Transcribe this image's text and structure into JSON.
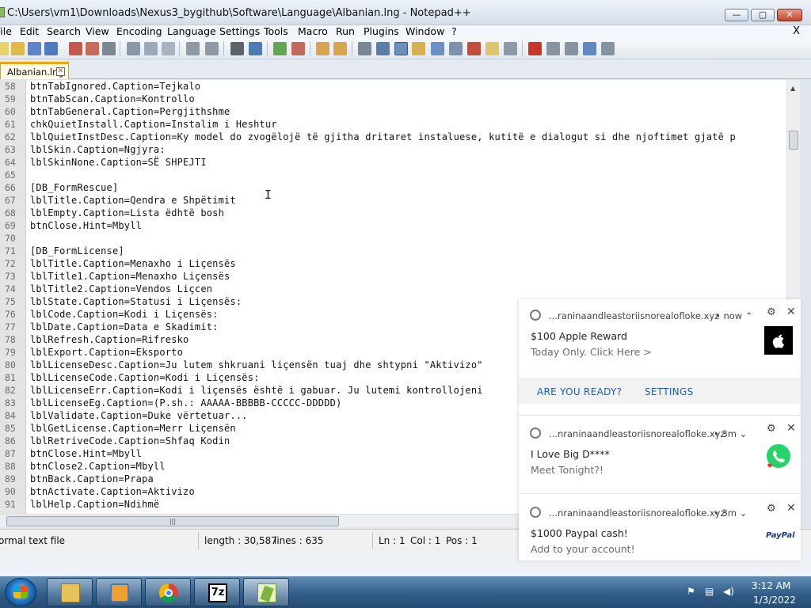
{
  "window": {
    "title": "C:\\Users\\vm1\\Downloads\\Nexus3_bygithub\\Software\\Language\\Albanian.lng - Notepad++",
    "min_label": "—",
    "max_label": "▢",
    "close_label": "✕"
  },
  "menu": {
    "items": [
      "File",
      "Edit",
      "Search",
      "View",
      "Encoding",
      "Language",
      "Settings",
      "Tools",
      "Macro",
      "Run",
      "Plugins",
      "Window",
      "?"
    ],
    "close": "X"
  },
  "tab": {
    "label": "Albanian.lng",
    "close": "✕"
  },
  "editor": {
    "lines": [
      {
        "n": "58",
        "t": "btnTabIgnored.Caption=Tejkalo"
      },
      {
        "n": "59",
        "t": "btnTabScan.Caption=Kontrollo"
      },
      {
        "n": "60",
        "t": "btnTabGeneral.Caption=Pergjithshme"
      },
      {
        "n": "61",
        "t": "chkQuietInstall.Caption=Instalim i Heshtur"
      },
      {
        "n": "62",
        "t": "lblQuietInstDesc.Caption=Ky model do zvogëlojë të gjitha dritaret instaluese, kutitë e dialogut si dhe njoftimet gjatë p"
      },
      {
        "n": "63",
        "t": "lblSkin.Caption=Ngjyra:"
      },
      {
        "n": "64",
        "t": "lblSkinNone.Caption=SË SHPEJTI"
      },
      {
        "n": "65",
        "t": ""
      },
      {
        "n": "66",
        "t": "[DB_FormRescue]"
      },
      {
        "n": "67",
        "t": "lblTitle.Caption=Qendra e Shpëtimit"
      },
      {
        "n": "68",
        "t": "lblEmpty.Caption=Lista ëdhtë bosh"
      },
      {
        "n": "69",
        "t": "btnClose.Hint=Mbyll"
      },
      {
        "n": "70",
        "t": ""
      },
      {
        "n": "71",
        "t": "[DB_FormLicense]"
      },
      {
        "n": "72",
        "t": "lblTitle.Caption=Menaxho i Liçensës"
      },
      {
        "n": "73",
        "t": "lblTitle1.Caption=Menaxho Liçensës"
      },
      {
        "n": "74",
        "t": "lblTitle2.Caption=Vendos Liçcen"
      },
      {
        "n": "75",
        "t": "lblState.Caption=Statusi i Liçensës:"
      },
      {
        "n": "76",
        "t": "lblCode.Caption=Kodi i Liçensës:"
      },
      {
        "n": "77",
        "t": "lblDate.Caption=Data e Skadimit:"
      },
      {
        "n": "78",
        "t": "lblRefresh.Caption=Rifresko"
      },
      {
        "n": "79",
        "t": "lblExport.Caption=Eksporto"
      },
      {
        "n": "80",
        "t": "lblLicenseDesc.Caption=Ju lutem shkruani liçensën tuaj dhe shtypni \"Aktivizo\""
      },
      {
        "n": "81",
        "t": "lblLicenseCode.Caption=Kodi i Liçensës:"
      },
      {
        "n": "82",
        "t": "lblLicenseErr.Caption=Kodi i liçensës është i gabuar. Ju lutemi kontrollojeni"
      },
      {
        "n": "83",
        "t": "lblLicenseEg.Caption=(P.sh.: AAAAA-BBBBB-CCCCC-DDDDD)"
      },
      {
        "n": "84",
        "t": "lblValidate.Caption=Duke vërtetuar..."
      },
      {
        "n": "85",
        "t": "lblGetLicense.Caption=Merr Liçensën"
      },
      {
        "n": "86",
        "t": "lblRetriveCode.Caption=Shfaq Kodin"
      },
      {
        "n": "87",
        "t": "btnClose.Hint=Mbyll"
      },
      {
        "n": "88",
        "t": "btnClose2.Caption=Mbyll"
      },
      {
        "n": "89",
        "t": "btnBack.Caption=Prapa"
      },
      {
        "n": "90",
        "t": "btnActivate.Caption=Aktivizo"
      },
      {
        "n": "91",
        "t": "lblHelp.Caption=Ndihmë"
      }
    ],
    "caret": "I"
  },
  "status": {
    "type": "ormal text file",
    "length": "length : 30,587",
    "lines": "lines : 635",
    "ln": "Ln : 1",
    "col": "Col : 1",
    "pos": "Pos : 1"
  },
  "notifications": [
    {
      "source": "...raninaandleastoriisnorealofloke.xyz",
      "time": "• now ⌃",
      "title": "$100 Apple Reward",
      "body": "Today Only. Click Here >",
      "badge": "apple-icon",
      "actions": [
        "ARE YOU READY?",
        "SETTINGS"
      ]
    },
    {
      "source": "...nraninaandleastoriisnorealofloke.xyz",
      "time": "• 3m ⌄",
      "title": "I Love Big D****",
      "body": "Meet Tonight?!",
      "badge": "whatsapp-icon"
    },
    {
      "source": "...nraninaandleastoriisnorealofloke.xyz",
      "time": "• 3m ⌄",
      "title": "$1000 Paypal cash!",
      "body": "Add to your account!",
      "badge": "PayPal"
    }
  ],
  "taskbar": {
    "time": "3:12 AM",
    "date": "1/3/2022",
    "sevenzip_label": "7z"
  },
  "colors": {
    "accent_tab": "#f5a400",
    "whatsapp": "#25d366",
    "paypal": "#1a3c8f",
    "link": "#1a5fb4"
  }
}
